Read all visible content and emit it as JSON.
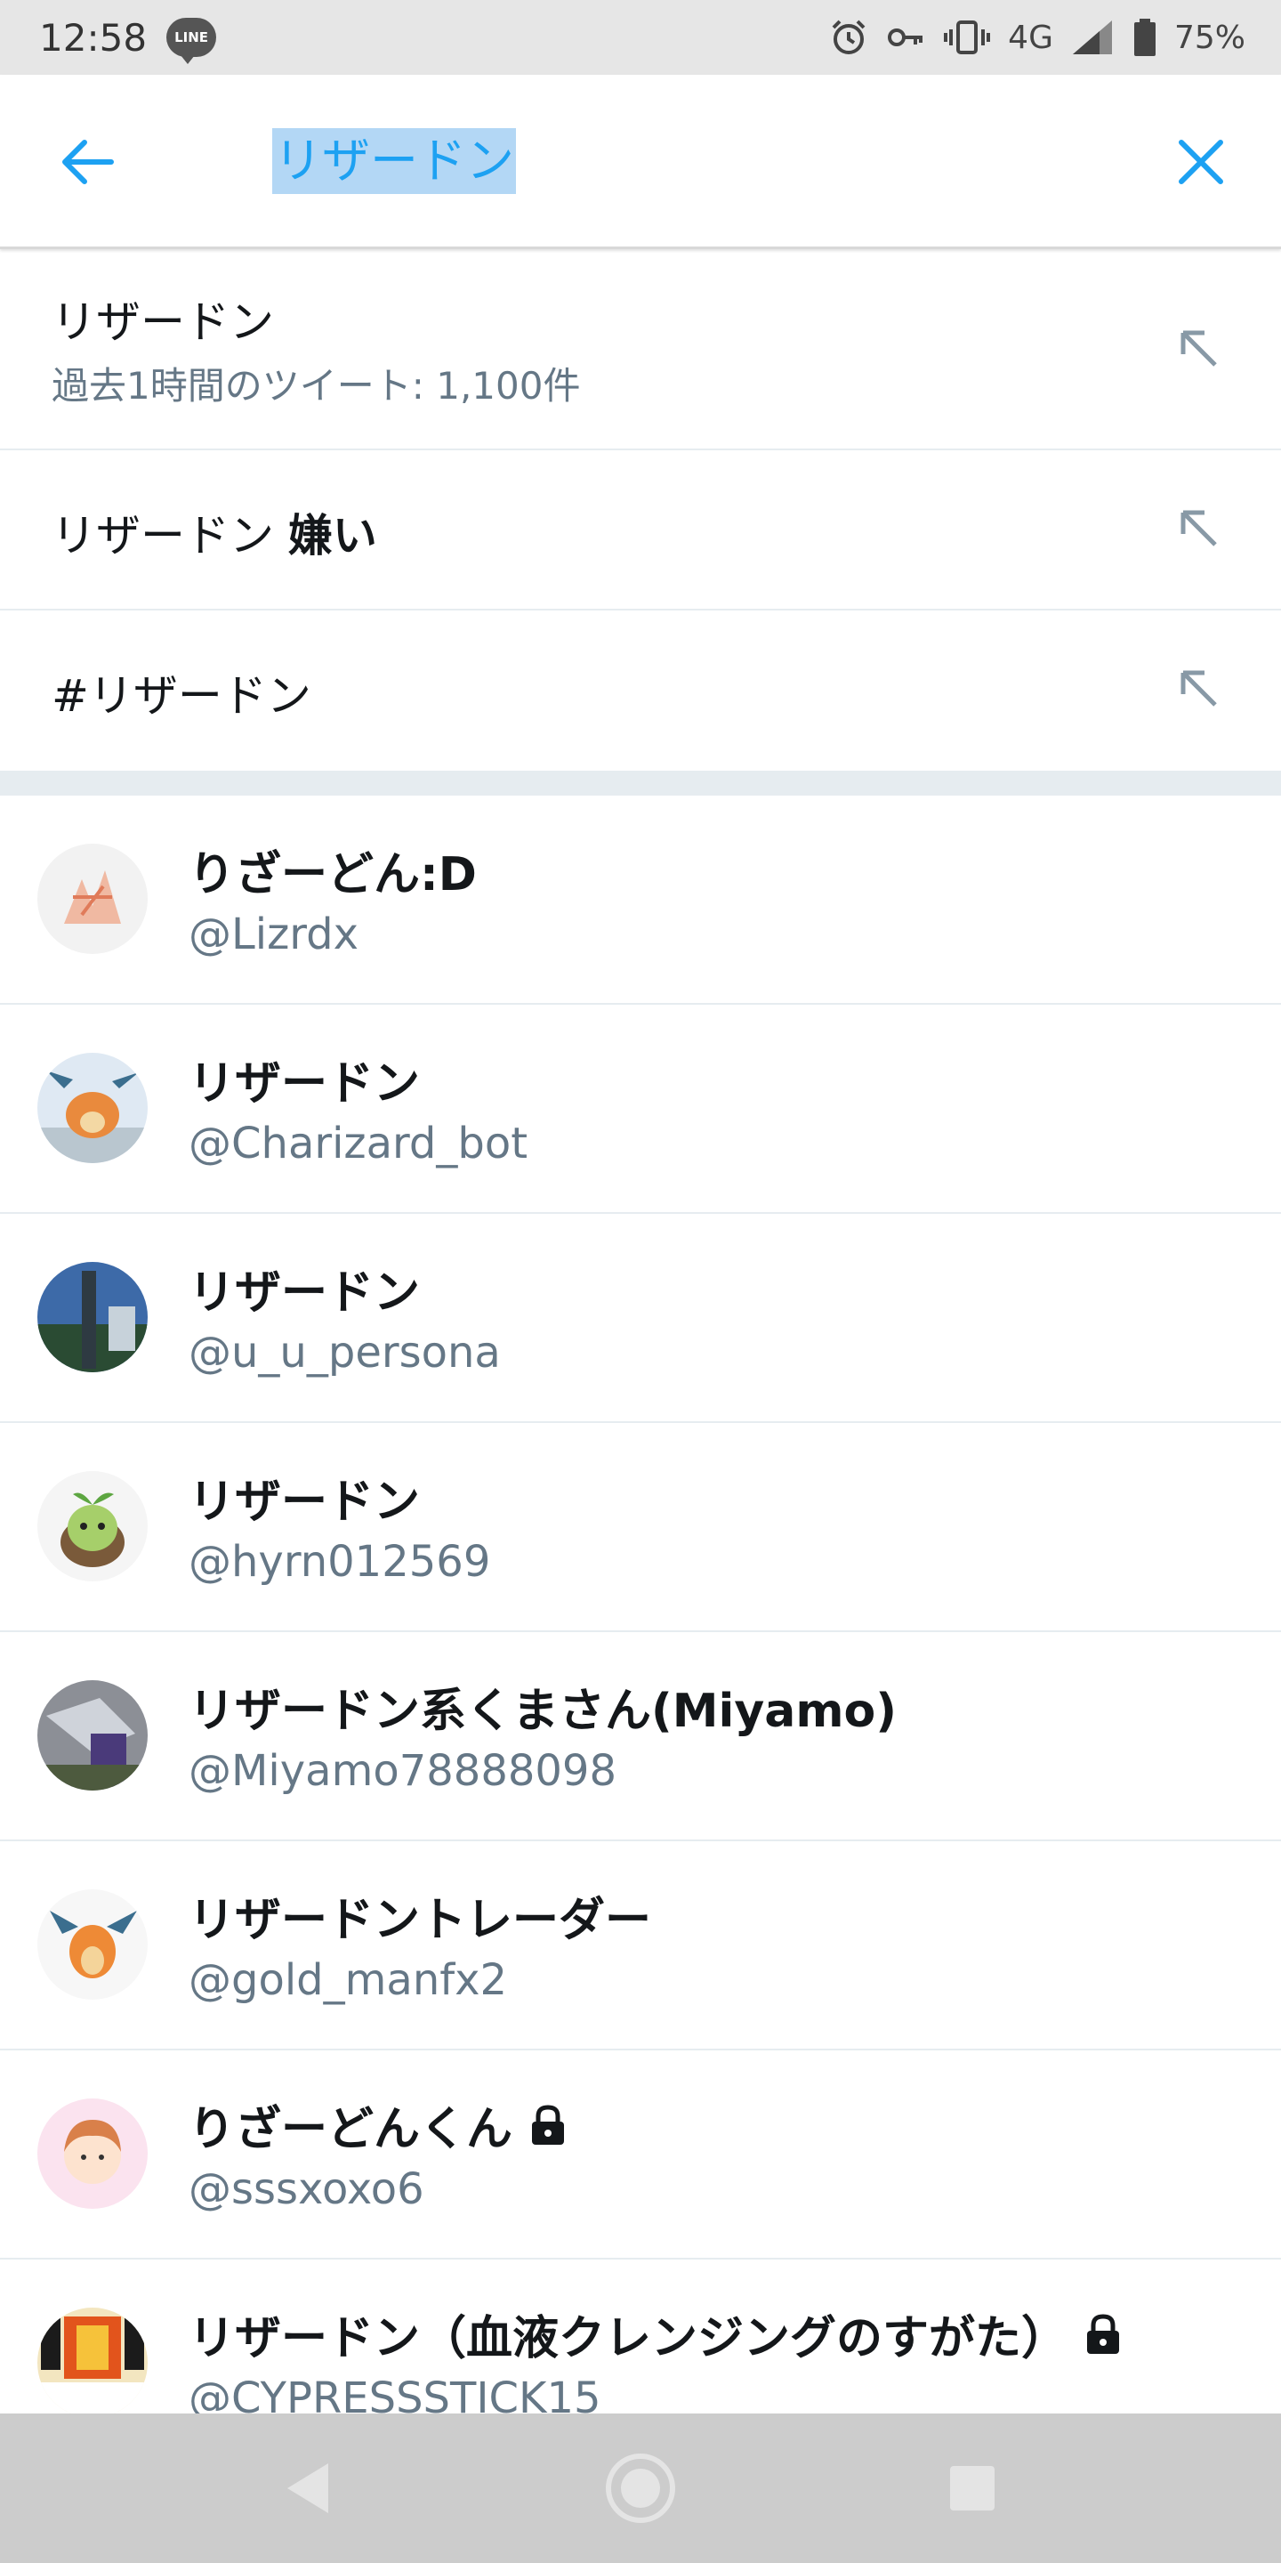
{
  "status_bar": {
    "time": "12:58",
    "line_badge": "LINE",
    "network": "4G",
    "battery": "75%",
    "icons": [
      "line-icon",
      "alarm-icon",
      "key-icon",
      "vibrate-icon",
      "signal-icon",
      "battery-icon"
    ]
  },
  "search": {
    "query": "リザードン",
    "back_icon": "arrow-left-icon",
    "clear_icon": "close-icon",
    "accent_color": "#1da1f2",
    "highlight_color": "#b3d7f5"
  },
  "suggestions": [
    {
      "title": "リザードン",
      "subtitle": "過去1時間のツイート: 1,100件"
    },
    {
      "title": "リザードン",
      "title_bold": "嫌い"
    },
    {
      "title": "#リザードン"
    }
  ],
  "users": [
    {
      "name": "りざーどん:D",
      "handle": "@Lizrdx",
      "locked": false
    },
    {
      "name": "リザードン",
      "handle": "@Charizard_bot",
      "locked": false
    },
    {
      "name": "リザードン",
      "handle": "@u_u_persona",
      "locked": false
    },
    {
      "name": "リザードン",
      "handle": "@hyrn012569",
      "locked": false
    },
    {
      "name": "リザードン系くまさん(Miyamo)",
      "handle": "@Miyamo78888098",
      "locked": false
    },
    {
      "name": "リザードントレーダー",
      "handle": "@gold_manfx2",
      "locked": false
    },
    {
      "name": "りざーどんくん",
      "handle": "@sssxoxo6",
      "locked": true
    },
    {
      "name": "リザードン（血液クレンジングのすがた）",
      "handle": "@CYPRESSSTICK15",
      "locked": true
    }
  ],
  "nav_bar": {
    "icons": [
      "back-triangle-icon",
      "home-circle-icon",
      "recents-square-icon"
    ]
  }
}
